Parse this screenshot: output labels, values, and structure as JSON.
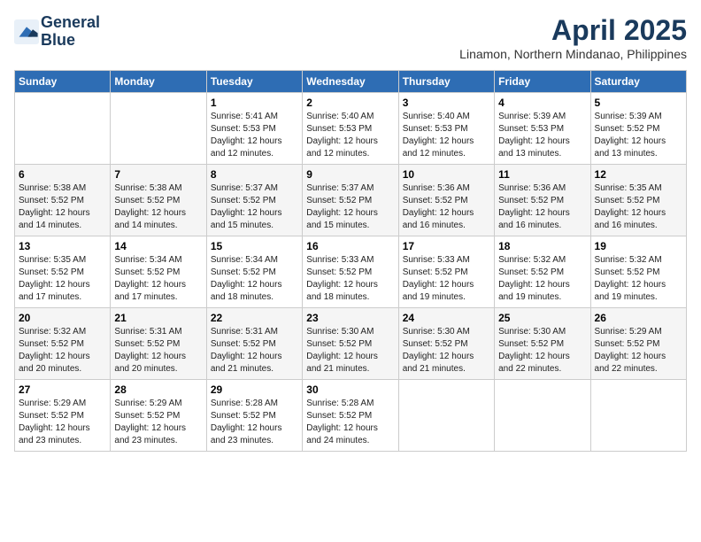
{
  "logo": {
    "line1": "General",
    "line2": "Blue"
  },
  "title": "April 2025",
  "subtitle": "Linamon, Northern Mindanao, Philippines",
  "weekdays": [
    "Sunday",
    "Monday",
    "Tuesday",
    "Wednesday",
    "Thursday",
    "Friday",
    "Saturday"
  ],
  "weeks": [
    [
      {
        "day": "",
        "sunrise": "",
        "sunset": "",
        "daylight": ""
      },
      {
        "day": "",
        "sunrise": "",
        "sunset": "",
        "daylight": ""
      },
      {
        "day": "1",
        "sunrise": "Sunrise: 5:41 AM",
        "sunset": "Sunset: 5:53 PM",
        "daylight": "Daylight: 12 hours and 12 minutes."
      },
      {
        "day": "2",
        "sunrise": "Sunrise: 5:40 AM",
        "sunset": "Sunset: 5:53 PM",
        "daylight": "Daylight: 12 hours and 12 minutes."
      },
      {
        "day": "3",
        "sunrise": "Sunrise: 5:40 AM",
        "sunset": "Sunset: 5:53 PM",
        "daylight": "Daylight: 12 hours and 12 minutes."
      },
      {
        "day": "4",
        "sunrise": "Sunrise: 5:39 AM",
        "sunset": "Sunset: 5:53 PM",
        "daylight": "Daylight: 12 hours and 13 minutes."
      },
      {
        "day": "5",
        "sunrise": "Sunrise: 5:39 AM",
        "sunset": "Sunset: 5:52 PM",
        "daylight": "Daylight: 12 hours and 13 minutes."
      }
    ],
    [
      {
        "day": "6",
        "sunrise": "Sunrise: 5:38 AM",
        "sunset": "Sunset: 5:52 PM",
        "daylight": "Daylight: 12 hours and 14 minutes."
      },
      {
        "day": "7",
        "sunrise": "Sunrise: 5:38 AM",
        "sunset": "Sunset: 5:52 PM",
        "daylight": "Daylight: 12 hours and 14 minutes."
      },
      {
        "day": "8",
        "sunrise": "Sunrise: 5:37 AM",
        "sunset": "Sunset: 5:52 PM",
        "daylight": "Daylight: 12 hours and 15 minutes."
      },
      {
        "day": "9",
        "sunrise": "Sunrise: 5:37 AM",
        "sunset": "Sunset: 5:52 PM",
        "daylight": "Daylight: 12 hours and 15 minutes."
      },
      {
        "day": "10",
        "sunrise": "Sunrise: 5:36 AM",
        "sunset": "Sunset: 5:52 PM",
        "daylight": "Daylight: 12 hours and 16 minutes."
      },
      {
        "day": "11",
        "sunrise": "Sunrise: 5:36 AM",
        "sunset": "Sunset: 5:52 PM",
        "daylight": "Daylight: 12 hours and 16 minutes."
      },
      {
        "day": "12",
        "sunrise": "Sunrise: 5:35 AM",
        "sunset": "Sunset: 5:52 PM",
        "daylight": "Daylight: 12 hours and 16 minutes."
      }
    ],
    [
      {
        "day": "13",
        "sunrise": "Sunrise: 5:35 AM",
        "sunset": "Sunset: 5:52 PM",
        "daylight": "Daylight: 12 hours and 17 minutes."
      },
      {
        "day": "14",
        "sunrise": "Sunrise: 5:34 AM",
        "sunset": "Sunset: 5:52 PM",
        "daylight": "Daylight: 12 hours and 17 minutes."
      },
      {
        "day": "15",
        "sunrise": "Sunrise: 5:34 AM",
        "sunset": "Sunset: 5:52 PM",
        "daylight": "Daylight: 12 hours and 18 minutes."
      },
      {
        "day": "16",
        "sunrise": "Sunrise: 5:33 AM",
        "sunset": "Sunset: 5:52 PM",
        "daylight": "Daylight: 12 hours and 18 minutes."
      },
      {
        "day": "17",
        "sunrise": "Sunrise: 5:33 AM",
        "sunset": "Sunset: 5:52 PM",
        "daylight": "Daylight: 12 hours and 19 minutes."
      },
      {
        "day": "18",
        "sunrise": "Sunrise: 5:32 AM",
        "sunset": "Sunset: 5:52 PM",
        "daylight": "Daylight: 12 hours and 19 minutes."
      },
      {
        "day": "19",
        "sunrise": "Sunrise: 5:32 AM",
        "sunset": "Sunset: 5:52 PM",
        "daylight": "Daylight: 12 hours and 19 minutes."
      }
    ],
    [
      {
        "day": "20",
        "sunrise": "Sunrise: 5:32 AM",
        "sunset": "Sunset: 5:52 PM",
        "daylight": "Daylight: 12 hours and 20 minutes."
      },
      {
        "day": "21",
        "sunrise": "Sunrise: 5:31 AM",
        "sunset": "Sunset: 5:52 PM",
        "daylight": "Daylight: 12 hours and 20 minutes."
      },
      {
        "day": "22",
        "sunrise": "Sunrise: 5:31 AM",
        "sunset": "Sunset: 5:52 PM",
        "daylight": "Daylight: 12 hours and 21 minutes."
      },
      {
        "day": "23",
        "sunrise": "Sunrise: 5:30 AM",
        "sunset": "Sunset: 5:52 PM",
        "daylight": "Daylight: 12 hours and 21 minutes."
      },
      {
        "day": "24",
        "sunrise": "Sunrise: 5:30 AM",
        "sunset": "Sunset: 5:52 PM",
        "daylight": "Daylight: 12 hours and 21 minutes."
      },
      {
        "day": "25",
        "sunrise": "Sunrise: 5:30 AM",
        "sunset": "Sunset: 5:52 PM",
        "daylight": "Daylight: 12 hours and 22 minutes."
      },
      {
        "day": "26",
        "sunrise": "Sunrise: 5:29 AM",
        "sunset": "Sunset: 5:52 PM",
        "daylight": "Daylight: 12 hours and 22 minutes."
      }
    ],
    [
      {
        "day": "27",
        "sunrise": "Sunrise: 5:29 AM",
        "sunset": "Sunset: 5:52 PM",
        "daylight": "Daylight: 12 hours and 23 minutes."
      },
      {
        "day": "28",
        "sunrise": "Sunrise: 5:29 AM",
        "sunset": "Sunset: 5:52 PM",
        "daylight": "Daylight: 12 hours and 23 minutes."
      },
      {
        "day": "29",
        "sunrise": "Sunrise: 5:28 AM",
        "sunset": "Sunset: 5:52 PM",
        "daylight": "Daylight: 12 hours and 23 minutes."
      },
      {
        "day": "30",
        "sunrise": "Sunrise: 5:28 AM",
        "sunset": "Sunset: 5:52 PM",
        "daylight": "Daylight: 12 hours and 24 minutes."
      },
      {
        "day": "",
        "sunrise": "",
        "sunset": "",
        "daylight": ""
      },
      {
        "day": "",
        "sunrise": "",
        "sunset": "",
        "daylight": ""
      },
      {
        "day": "",
        "sunrise": "",
        "sunset": "",
        "daylight": ""
      }
    ]
  ]
}
